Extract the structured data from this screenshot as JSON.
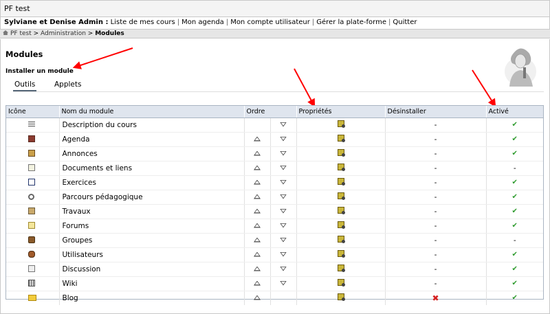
{
  "site": {
    "title": "PF test"
  },
  "user_bar": {
    "user_name": "Sylviane et Denise Admin :",
    "links": [
      "Liste de mes cours",
      "Mon agenda",
      "Mon compte utilisateur",
      "Gérer la plate-forme",
      "Quitter"
    ]
  },
  "breadcrumb": {
    "items": [
      "PF test",
      "Administration"
    ],
    "current": "Modules",
    "separator": ">"
  },
  "main": {
    "title": "Modules",
    "install_link": "Installer un module",
    "tabs": [
      {
        "label": "Outils",
        "active": true
      },
      {
        "label": "Applets",
        "active": false
      }
    ]
  },
  "table": {
    "headers": [
      "Icône",
      "Nom du module",
      "Ordre",
      "Propriétés",
      "Désinstaller",
      "Activé"
    ],
    "rows": [
      {
        "icon": "course-description-icon",
        "name": "Description du cours",
        "up": false,
        "down": true,
        "uninstall": "-",
        "active": "✔"
      },
      {
        "icon": "agenda-icon",
        "name": "Agenda",
        "up": true,
        "down": true,
        "uninstall": "-",
        "active": "✔"
      },
      {
        "icon": "announcements-icon",
        "name": "Annonces",
        "up": true,
        "down": true,
        "uninstall": "-",
        "active": "✔"
      },
      {
        "icon": "documents-icon",
        "name": "Documents et liens",
        "up": true,
        "down": true,
        "uninstall": "-",
        "active": "-"
      },
      {
        "icon": "exercises-icon",
        "name": "Exercices",
        "up": true,
        "down": true,
        "uninstall": "-",
        "active": "✔"
      },
      {
        "icon": "learning-path-icon",
        "name": "Parcours pédagogique",
        "up": true,
        "down": true,
        "uninstall": "-",
        "active": "✔"
      },
      {
        "icon": "assignments-icon",
        "name": "Travaux",
        "up": true,
        "down": true,
        "uninstall": "-",
        "active": "✔"
      },
      {
        "icon": "forums-icon",
        "name": "Forums",
        "up": true,
        "down": true,
        "uninstall": "-",
        "active": "✔"
      },
      {
        "icon": "groups-icon",
        "name": "Groupes",
        "up": true,
        "down": true,
        "uninstall": "-",
        "active": "-"
      },
      {
        "icon": "users-icon",
        "name": "Utilisateurs",
        "up": true,
        "down": true,
        "uninstall": "-",
        "active": "✔"
      },
      {
        "icon": "chat-icon",
        "name": "Discussion",
        "up": true,
        "down": true,
        "uninstall": "-",
        "active": "✔"
      },
      {
        "icon": "wiki-icon",
        "name": "Wiki",
        "up": true,
        "down": true,
        "uninstall": "-",
        "active": "✔"
      },
      {
        "icon": "blog-icon",
        "name": "Blog",
        "up": true,
        "down": false,
        "uninstall": "✖",
        "active": "✔"
      }
    ]
  },
  "colors": {
    "header_bg": "#dfe5ee",
    "check": "#2e9b2e",
    "cross": "#d42020",
    "annotation_arrow": "#ff0000"
  }
}
